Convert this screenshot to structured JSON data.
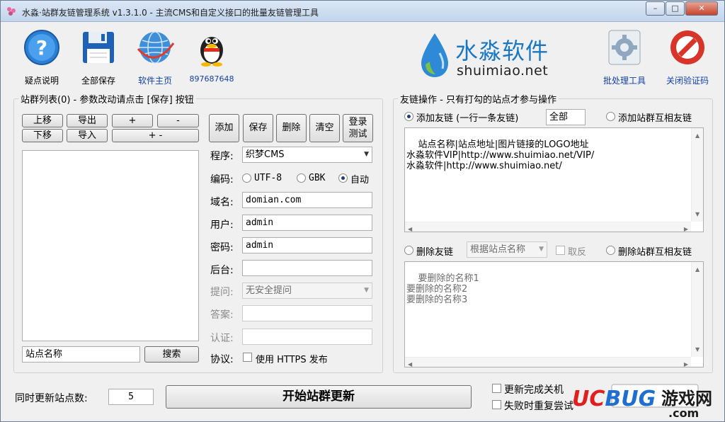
{
  "window": {
    "title": "水淼·站群友链管理系统 v1.3.1.0 - 主流CMS和自定义接口的批量友链管理工具",
    "min_glyph": "–",
    "max_glyph": "□",
    "close_glyph": "✕"
  },
  "toolbar": {
    "help": "疑点说明",
    "save_all": "全部保存",
    "homepage": "软件主页",
    "qq": "897687648",
    "batch_tool": "批处理工具",
    "close_captcha": "关闭验证码"
  },
  "brand": {
    "cn": "水淼软件",
    "en": "shuimiao.net"
  },
  "site_list": {
    "title": "站群列表(0) - 参数改动请点击 [保存] 按钮",
    "move_up": "上移",
    "move_down": "下移",
    "export": "导出",
    "import": "导入",
    "plus": "+",
    "minus": "-",
    "plus_minus": "+ -",
    "search_value": "站点名称",
    "search_button": "搜索"
  },
  "site_form": {
    "add": "添加",
    "save": "保存",
    "delete": "删除",
    "clear": "清空",
    "login_test_1": "登录",
    "login_test_2": "测试",
    "program_label": "程序:",
    "program_value": "织梦CMS",
    "encoding_label": "编码:",
    "enc_utf8": "UTF-8",
    "enc_gbk": "GBK",
    "enc_auto": "自动",
    "domain_label": "域名:",
    "domain_value": "domian.com",
    "user_label": "用户:",
    "user_value": "admin",
    "password_label": "密码:",
    "password_value": "admin",
    "backend_label": "后台:",
    "backend_value": "",
    "question_label": "提问:",
    "question_value": "无安全提问",
    "answer_label": "答案:",
    "answer_value": "",
    "verify_label": "认证:",
    "verify_value": "",
    "protocol_label": "协议:",
    "https_option": "使用 HTTPS 发布"
  },
  "link_ops": {
    "title": "友链操作 - 只有打勾的站点才参与操作",
    "add_link": "添加友链 (一行一条友链)",
    "all_value": "全部",
    "add_mutual": "添加站群互相友链",
    "add_text": "站点名称|站点地址|图片链接的LOGO地址\n水淼软件VIP|http://www.shuimiao.net/VIP/\n水淼软件|http://www.shuimiao.net/",
    "delete_link": "删除友链",
    "delete_by": "根据站点名称",
    "invert": "取反",
    "delete_mutual": "删除站群互相友链",
    "delete_text": "要删除的名称1\n要删除的名称2\n要删除的名称3"
  },
  "footer": {
    "concurrent_label": "同时更新站点数:",
    "concurrent_value": "5",
    "start_button": "开始站群更新",
    "shutdown_opt": "更新完成关机",
    "retry_opt": "失败时重复尝试",
    "watermark_brand": "UCBUG",
    "watermark_cn": "游戏网",
    "watermark_dom": ".com"
  },
  "colors": {
    "accent_blue": "#1a78c2",
    "link_blue": "#1240a8",
    "close_red": "#c5442d",
    "watermark_red": "#e0201f",
    "watermark_blue": "#1f6fd1"
  }
}
